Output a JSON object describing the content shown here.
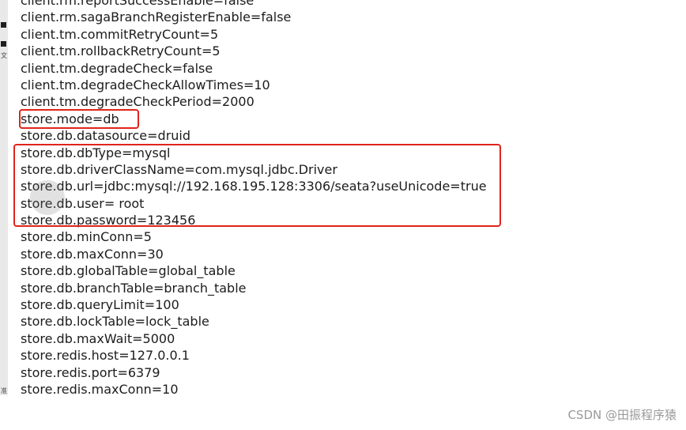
{
  "editor": {
    "lines": [
      "client.rm.reportSuccessEnable=false",
      "client.rm.sagaBranchRegisterEnable=false",
      "client.tm.commitRetryCount=5",
      "client.tm.rollbackRetryCount=5",
      "client.tm.degradeCheck=false",
      "client.tm.degradeCheckAllowTimes=10",
      "client.tm.degradeCheckPeriod=2000",
      "store.mode=db",
      "store.db.datasource=druid",
      "store.db.dbType=mysql",
      "store.db.driverClassName=com.mysql.jdbc.Driver",
      "store.db.url=jdbc:mysql://192.168.195.128:3306/seata?useUnicode=true",
      "store.db.user= root",
      "store.db.password=123456",
      "store.db.minConn=5",
      "store.db.maxConn=30",
      "store.db.globalTable=global_table",
      "store.db.branchTable=branch_table",
      "store.db.queryLimit=100",
      "store.db.lockTable=lock_table",
      "store.db.maxWait=5000",
      "store.redis.host=127.0.0.1",
      "store.redis.port=6379",
      "store.redis.maxConn=10"
    ]
  },
  "gutter": {
    "glyph_1": "文",
    "glyph_2": "准"
  },
  "highlight_color": "#e0241b",
  "watermark": "CSDN @田振程序猿"
}
